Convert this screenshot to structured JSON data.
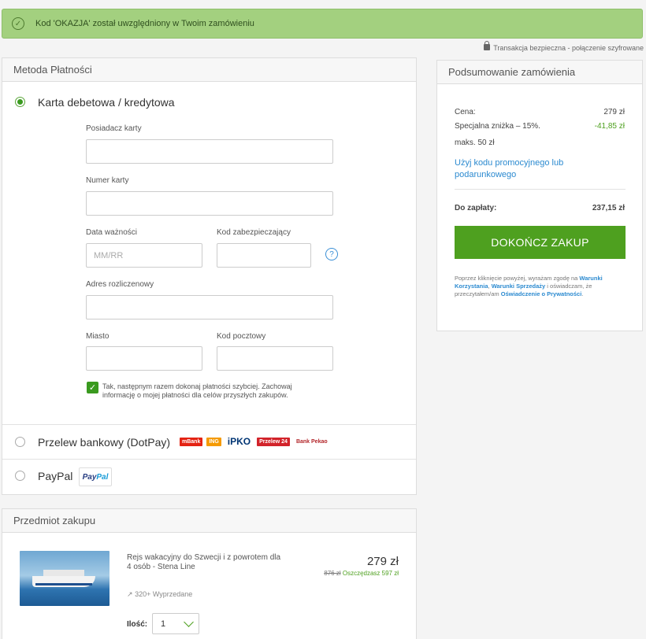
{
  "banner": {
    "message": "Kod 'OKAZJA' został uwzględniony w Twoim zamówieniu"
  },
  "security": {
    "text": "Transakcja bezpieczna - połączenie szyfrowane"
  },
  "payment": {
    "header": "Metoda Płatności",
    "card": {
      "label": "Karta debetowa / kredytowa",
      "selected": true,
      "fields": {
        "holder_label": "Posiadacz karty",
        "holder_value": "",
        "number_label": "Numer karty",
        "number_value": "",
        "expiry_label": "Data ważności",
        "expiry_placeholder": "MM/RR",
        "cvv_label": "Kod zabezpieczający",
        "address_label": "Adres rozliczenowy",
        "city_label": "Miasto",
        "postal_label": "Kod pocztowy"
      },
      "help_glyph": "?",
      "save_checked": true,
      "save_text": "Tak, następnym razem dokonaj płatności szybciej. Zachowaj informację o mojej płatności dla celów przyszłych zakupów."
    },
    "bank": {
      "label": "Przelew bankowy (DotPay)",
      "logos": [
        "mBank",
        "ING",
        "iPKO",
        "Przelew 24",
        "Bank Pekao"
      ]
    },
    "paypal": {
      "label": "PayPal",
      "logo_pay": "Pay",
      "logo_pal": "Pal"
    }
  },
  "summary": {
    "header": "Podsumowanie zamówienia",
    "price_label": "Cena:",
    "price_value": "279 zł",
    "discount_label": "Specjalna zniżka – 15%.",
    "discount_value": "-41,85 zł",
    "discount_note": "maks. 50 zł",
    "promo_link": "Użyj kodu promocyjnego lub podarunkowego",
    "total_label": "Do zapłaty:",
    "total_value": "237,15 zł",
    "buy_button": "DOKOŃCZ ZAKUP",
    "terms": {
      "prefix": "Poprzez kliknięcie powyżej, wyrażam zgodę na",
      "link1": "Warunki Korzystania",
      "sep": ",",
      "link2": "Warunki Sprzedaży",
      "mid": "i oświadczam, że przeczytałem/am",
      "link3": "Oświadczenie o Prywatności",
      "end": "."
    }
  },
  "item": {
    "header": "Przedmiot zakupu",
    "title": "Rejs wakacyjny do Szwecji i z powrotem dla 4 osób - Stena Line",
    "price": "279 zł",
    "old_price": "876 zł",
    "savings": "Oszczędzasz 597 zł",
    "sold": "320+ Wyprzedane",
    "qty_label": "Ilość:",
    "qty_value": "1"
  },
  "colors": {
    "accent": "#4ea01f",
    "link": "#2b8ad0",
    "banner_bg": "#a3d07f"
  }
}
